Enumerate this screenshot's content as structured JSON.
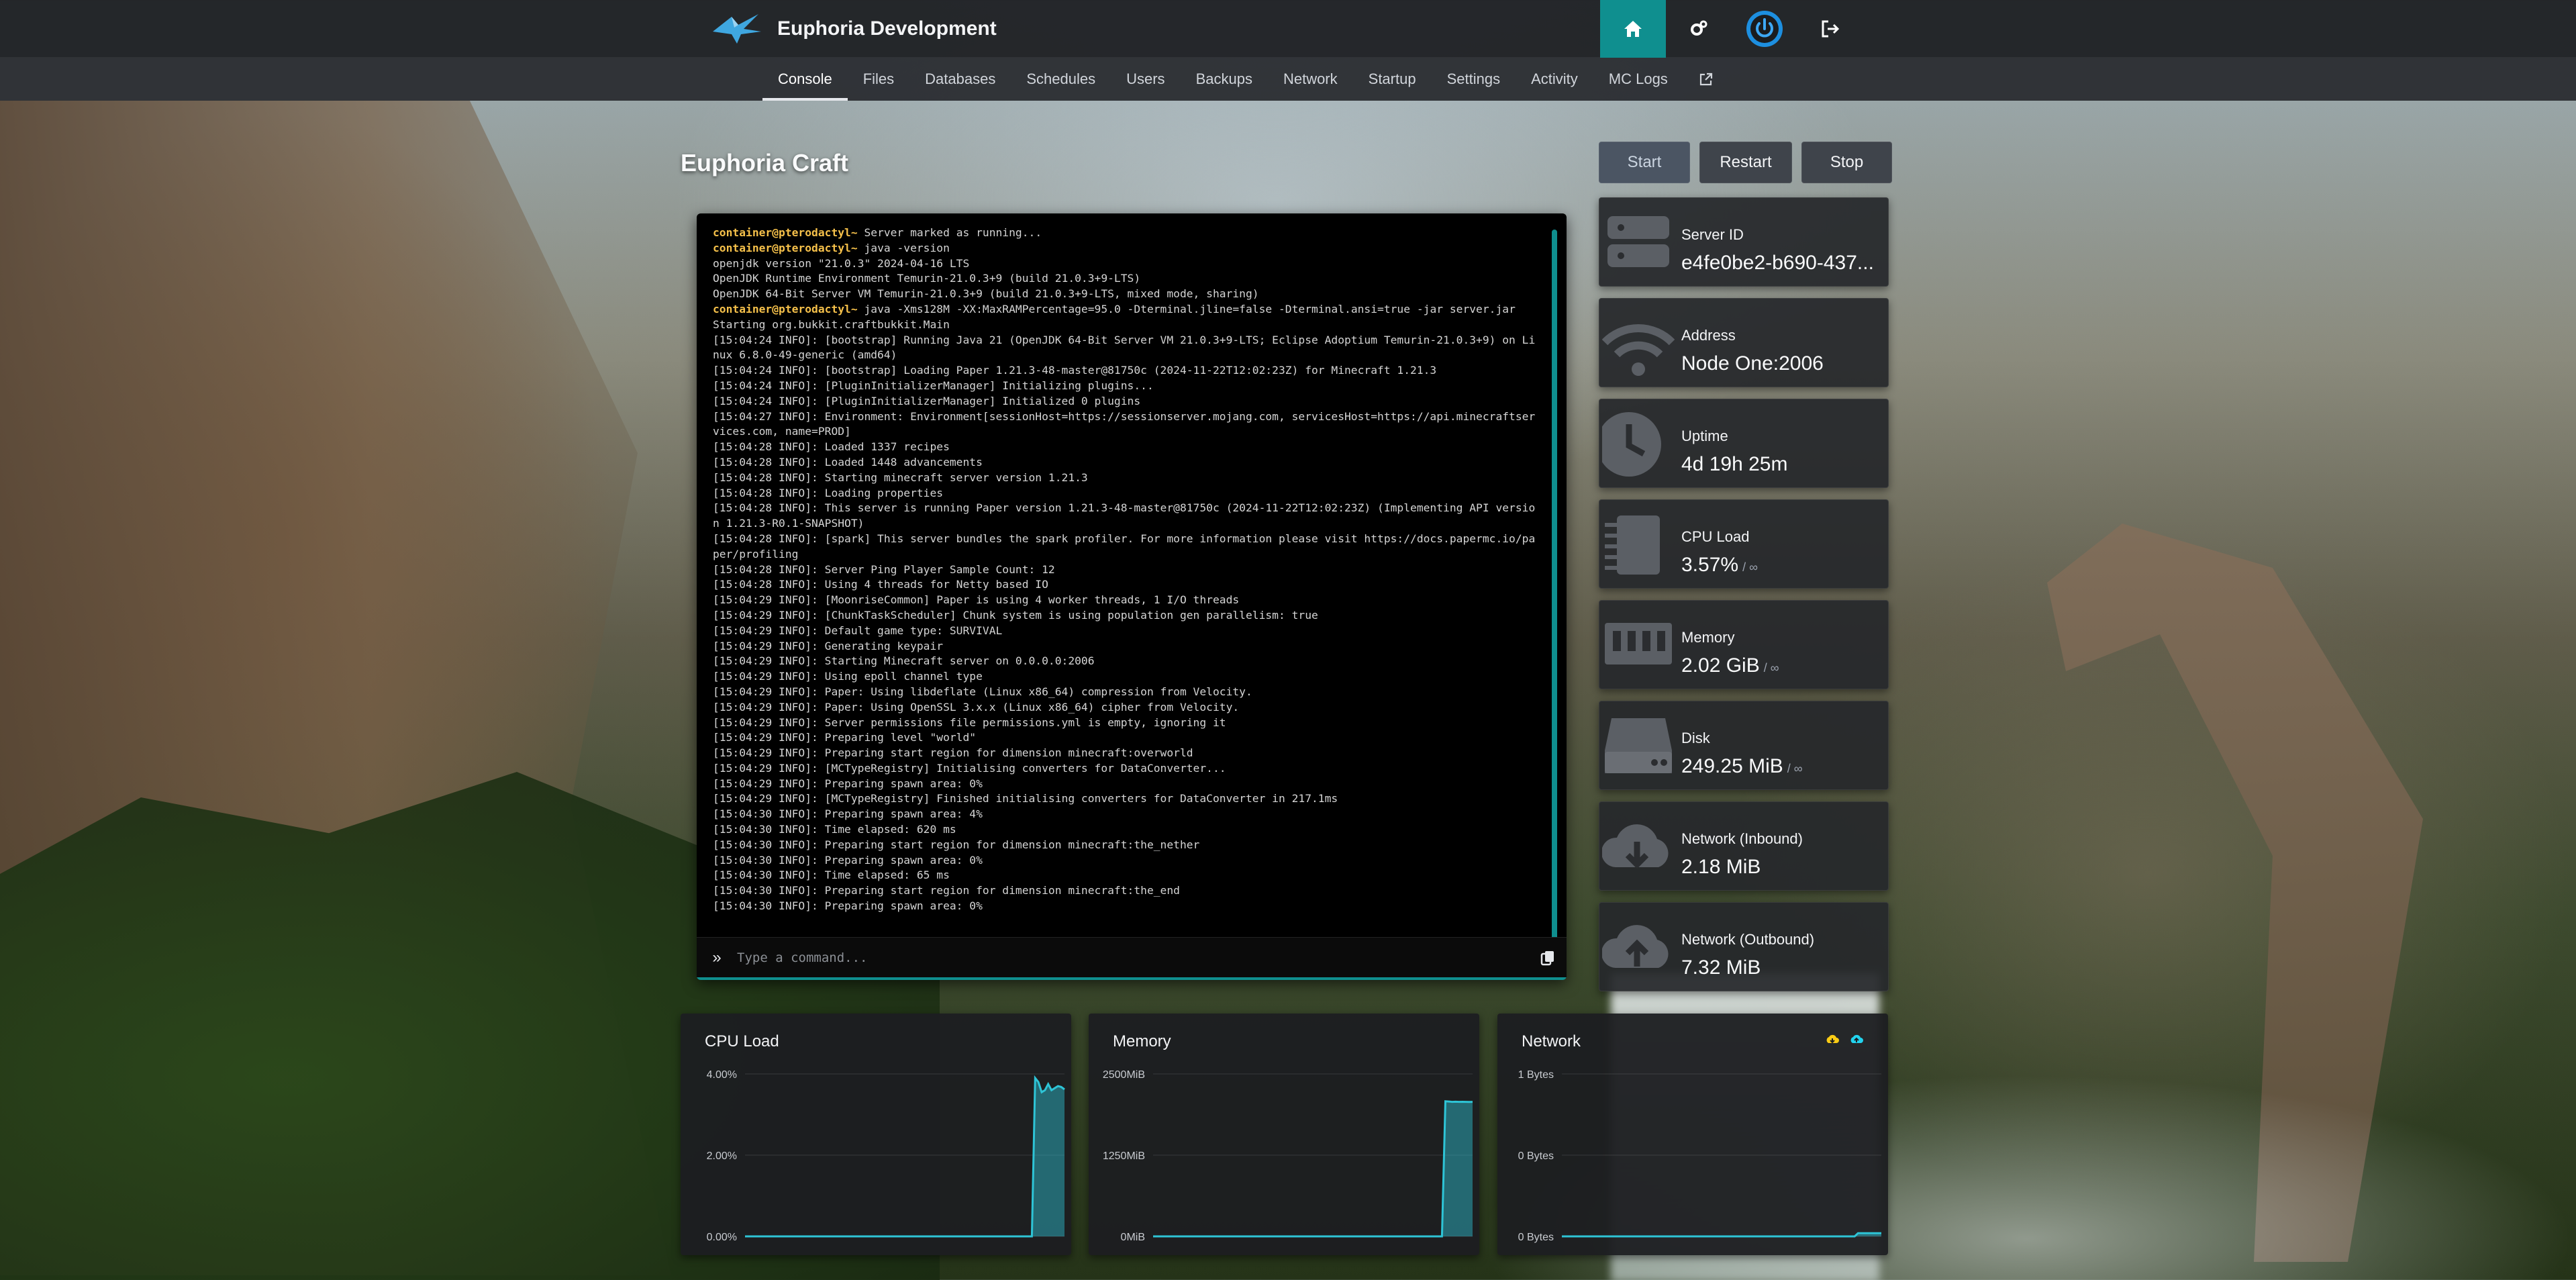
{
  "header": {
    "brand": "Euphoria Development",
    "icons": [
      "home-icon",
      "cogs-icon",
      "power-icon",
      "logout-icon"
    ]
  },
  "nav": {
    "items": [
      {
        "label": "Console",
        "active": true
      },
      {
        "label": "Files"
      },
      {
        "label": "Databases"
      },
      {
        "label": "Schedules"
      },
      {
        "label": "Users"
      },
      {
        "label": "Backups"
      },
      {
        "label": "Network"
      },
      {
        "label": "Startup"
      },
      {
        "label": "Settings"
      },
      {
        "label": "Activity"
      },
      {
        "label": "MC Logs"
      }
    ],
    "external_icon": "external-link-icon"
  },
  "server": {
    "name": "Euphoria Craft"
  },
  "power": {
    "start": "Start",
    "restart": "Restart",
    "stop": "Stop"
  },
  "console": {
    "lines": [
      {
        "prompt": "container@pterodactyl~",
        "text": " Server marked as running..."
      },
      {
        "prompt": "container@pterodactyl~",
        "text": " java -version"
      },
      {
        "text": "openjdk version \"21.0.3\" 2024-04-16 LTS"
      },
      {
        "text": "OpenJDK Runtime Environment Temurin-21.0.3+9 (build 21.0.3+9-LTS)"
      },
      {
        "text": "OpenJDK 64-Bit Server VM Temurin-21.0.3+9 (build 21.0.3+9-LTS, mixed mode, sharing)"
      },
      {
        "prompt": "container@pterodactyl~",
        "text": " java -Xms128M -XX:MaxRAMPercentage=95.0 -Dterminal.jline=false -Dterminal.ansi=true -jar server.jar"
      },
      {
        "text": "Starting org.bukkit.craftbukkit.Main"
      },
      {
        "text": "[15:04:24 INFO]: [bootstrap] Running Java 21 (OpenJDK 64-Bit Server VM 21.0.3+9-LTS; Eclipse Adoptium Temurin-21.0.3+9) on Linux 6.8.0-49-generic (amd64)"
      },
      {
        "text": "[15:04:24 INFO]: [bootstrap] Loading Paper 1.21.3-48-master@81750c (2024-11-22T12:02:23Z) for Minecraft 1.21.3"
      },
      {
        "text": "[15:04:24 INFO]: [PluginInitializerManager] Initializing plugins..."
      },
      {
        "text": "[15:04:24 INFO]: [PluginInitializerManager] Initialized 0 plugins"
      },
      {
        "text": "[15:04:27 INFO]: Environment: Environment[sessionHost=https://sessionserver.mojang.com, servicesHost=https://api.minecraftservices.com, name=PROD]"
      },
      {
        "text": "[15:04:28 INFO]: Loaded 1337 recipes"
      },
      {
        "text": "[15:04:28 INFO]: Loaded 1448 advancements"
      },
      {
        "text": "[15:04:28 INFO]: Starting minecraft server version 1.21.3"
      },
      {
        "text": "[15:04:28 INFO]: Loading properties"
      },
      {
        "text": "[15:04:28 INFO]: This server is running Paper version 1.21.3-48-master@81750c (2024-11-22T12:02:23Z) (Implementing API version 1.21.3-R0.1-SNAPSHOT)"
      },
      {
        "text": "[15:04:28 INFO]: [spark] This server bundles the spark profiler. For more information please visit https://docs.papermc.io/paper/profiling"
      },
      {
        "text": "[15:04:28 INFO]: Server Ping Player Sample Count: 12"
      },
      {
        "text": "[15:04:28 INFO]: Using 4 threads for Netty based IO"
      },
      {
        "text": "[15:04:29 INFO]: [MoonriseCommon] Paper is using 4 worker threads, 1 I/O threads"
      },
      {
        "text": "[15:04:29 INFO]: [ChunkTaskScheduler] Chunk system is using population gen parallelism: true"
      },
      {
        "text": "[15:04:29 INFO]: Default game type: SURVIVAL"
      },
      {
        "text": "[15:04:29 INFO]: Generating keypair"
      },
      {
        "text": "[15:04:29 INFO]: Starting Minecraft server on 0.0.0.0:2006"
      },
      {
        "text": "[15:04:29 INFO]: Using epoll channel type"
      },
      {
        "text": "[15:04:29 INFO]: Paper: Using libdeflate (Linux x86_64) compression from Velocity."
      },
      {
        "text": "[15:04:29 INFO]: Paper: Using OpenSSL 3.x.x (Linux x86_64) cipher from Velocity."
      },
      {
        "text": "[15:04:29 INFO]: Server permissions file permissions.yml is empty, ignoring it"
      },
      {
        "text": "[15:04:29 INFO]: Preparing level \"world\""
      },
      {
        "text": "[15:04:29 INFO]: Preparing start region for dimension minecraft:overworld"
      },
      {
        "text": "[15:04:29 INFO]: [MCTypeRegistry] Initialising converters for DataConverter..."
      },
      {
        "text": "[15:04:29 INFO]: Preparing spawn area: 0%"
      },
      {
        "text": "[15:04:29 INFO]: [MCTypeRegistry] Finished initialising converters for DataConverter in 217.1ms"
      },
      {
        "text": "[15:04:30 INFO]: Preparing spawn area: 4%"
      },
      {
        "text": "[15:04:30 INFO]: Time elapsed: 620 ms"
      },
      {
        "text": "[15:04:30 INFO]: Preparing start region for dimension minecraft:the_nether"
      },
      {
        "text": "[15:04:30 INFO]: Preparing spawn area: 0%"
      },
      {
        "text": "[15:04:30 INFO]: Time elapsed: 65 ms"
      },
      {
        "text": "[15:04:30 INFO]: Preparing start region for dimension minecraft:the_end"
      },
      {
        "text": "[15:04:30 INFO]: Preparing spawn area: 0%"
      }
    ],
    "input_placeholder": "Type a command..."
  },
  "stats": [
    {
      "key": "server-id",
      "icon": "server-icon",
      "label": "Server ID",
      "value": "e4fe0be2-b690-437...",
      "limit": ""
    },
    {
      "key": "address",
      "icon": "wifi-icon",
      "label": "Address",
      "value": "Node One:2006",
      "limit": ""
    },
    {
      "key": "uptime",
      "icon": "clock-icon",
      "label": "Uptime",
      "value": "4d 19h 25m",
      "limit": ""
    },
    {
      "key": "cpu",
      "icon": "microchip-icon",
      "label": "CPU Load",
      "value": "3.57%",
      "limit": "/ ∞"
    },
    {
      "key": "memory",
      "icon": "memory-icon",
      "label": "Memory",
      "value": "2.02 GiB",
      "limit": "/ ∞"
    },
    {
      "key": "disk",
      "icon": "hdd-icon",
      "label": "Disk",
      "value": "249.25 MiB",
      "limit": "/ ∞"
    },
    {
      "key": "net-in",
      "icon": "cloud-download-icon",
      "label": "Network (Inbound)",
      "value": "2.18 MiB",
      "limit": ""
    },
    {
      "key": "net-out",
      "icon": "cloud-upload-icon",
      "label": "Network (Outbound)",
      "value": "7.32 MiB",
      "limit": ""
    }
  ],
  "chart_data": [
    {
      "type": "area",
      "title": "CPU Load",
      "yticks": [
        "4.00%",
        "2.00%",
        "0.00%"
      ],
      "ylim": [
        0,
        4
      ],
      "unit": "%",
      "color": "#2ec4d6",
      "series": [
        {
          "values": [
            0,
            0,
            0,
            0,
            0,
            0,
            0,
            0,
            0,
            0,
            0,
            0,
            0,
            0,
            0,
            0,
            0,
            0,
            0,
            0,
            0,
            0,
            0,
            0,
            0,
            0,
            0,
            0,
            0,
            0,
            0,
            0,
            0,
            0,
            0,
            0,
            0,
            0,
            0,
            0,
            0,
            0,
            0,
            0,
            0,
            0,
            0,
            0,
            0,
            0,
            0,
            0,
            0,
            0,
            0,
            0,
            0,
            0,
            0,
            0,
            0,
            0,
            0,
            0,
            0,
            0,
            0,
            0,
            0,
            0,
            0,
            0,
            0,
            0,
            0,
            0,
            0,
            0,
            0,
            0,
            0,
            0,
            0,
            0,
            0,
            0,
            0,
            0,
            0,
            3.9,
            3.8,
            3.55,
            3.6,
            3.75,
            3.6,
            3.65,
            3.7,
            3.68,
            3.62
          ]
        }
      ]
    },
    {
      "type": "area",
      "title": "Memory",
      "yticks": [
        "2500MiB",
        "1250MiB",
        "0MiB"
      ],
      "ylim": [
        0,
        2500
      ],
      "unit": "MiB",
      "color": "#2ec4d6",
      "series": [
        {
          "values": [
            0,
            0,
            0,
            0,
            0,
            0,
            0,
            0,
            0,
            0,
            0,
            0,
            0,
            0,
            0,
            0,
            0,
            0,
            0,
            0,
            0,
            0,
            0,
            0,
            0,
            0,
            0,
            0,
            0,
            0,
            0,
            0,
            0,
            0,
            0,
            0,
            0,
            0,
            0,
            0,
            0,
            0,
            0,
            0,
            0,
            0,
            0,
            0,
            0,
            0,
            0,
            0,
            0,
            0,
            0,
            0,
            0,
            0,
            0,
            0,
            0,
            0,
            0,
            0,
            0,
            0,
            0,
            0,
            0,
            0,
            0,
            0,
            0,
            0,
            0,
            0,
            0,
            0,
            0,
            0,
            0,
            0,
            0,
            0,
            0,
            0,
            2080,
            2075,
            2070,
            2072,
            2070,
            2071,
            2070,
            2069,
            2070
          ]
        }
      ]
    },
    {
      "type": "area",
      "title": "Network",
      "yticks": [
        "1 Bytes",
        "0 Bytes",
        "0 Bytes"
      ],
      "ylim": [
        0,
        1
      ],
      "unit": "Bytes",
      "color": "#2ec4d6",
      "legend_icons": [
        "cloud-download-icon",
        "cloud-upload-icon"
      ],
      "legend_colors": [
        "#facc15",
        "#22d3ee"
      ],
      "series": [
        {
          "values": [
            0,
            0,
            0,
            0,
            0,
            0,
            0,
            0,
            0,
            0,
            0,
            0,
            0,
            0,
            0,
            0,
            0,
            0,
            0,
            0,
            0,
            0,
            0,
            0,
            0,
            0,
            0,
            0,
            0,
            0,
            0,
            0,
            0,
            0,
            0,
            0,
            0,
            0,
            0,
            0,
            0,
            0,
            0,
            0,
            0,
            0,
            0,
            0,
            0,
            0,
            0,
            0,
            0,
            0,
            0,
            0,
            0,
            0,
            0,
            0,
            0,
            0,
            0,
            0,
            0,
            0,
            0,
            0,
            0,
            0,
            0,
            0,
            0,
            0,
            0,
            0,
            0,
            0,
            0,
            0,
            0,
            0,
            0,
            0,
            0,
            0,
            0,
            0,
            0,
            0.02,
            0.02,
            0.02,
            0.02,
            0.02,
            0.02,
            0.02,
            0.02
          ]
        }
      ]
    }
  ]
}
